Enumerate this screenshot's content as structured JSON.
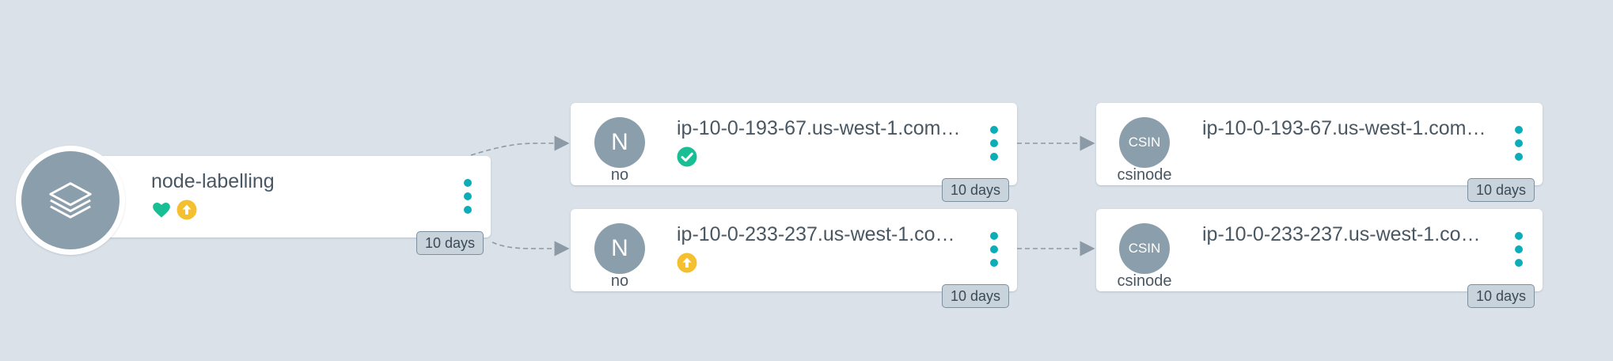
{
  "app_node": {
    "name": "node-labelling",
    "health_icon": "heart-icon",
    "sync_icon": "arrow-up-circle-icon",
    "age": "10 days"
  },
  "resources": [
    {
      "kind": "no",
      "kind_abbrev": "N",
      "name": "ip-10-0-193-67.us-west-1.com…",
      "status_icon": "check-circle-icon",
      "age": "10 days"
    },
    {
      "kind": "no",
      "kind_abbrev": "N",
      "name": "ip-10-0-233-237.us-west-1.co…",
      "status_icon": "arrow-up-circle-icon",
      "age": "10 days"
    },
    {
      "kind": "csinode",
      "kind_abbrev": "CSIN",
      "name": "ip-10-0-193-67.us-west-1.com…",
      "age": "10 days"
    },
    {
      "kind": "csinode",
      "kind_abbrev": "CSIN",
      "name": "ip-10-0-233-237.us-west-1.co…",
      "age": "10 days"
    }
  ],
  "colors": {
    "background": "#dae1e8",
    "healthy": "#18be94",
    "progressing": "#f4c030",
    "menu_dots": "#0dadb8",
    "node_circle": "#8b9eac",
    "edge": "#8b9aa6"
  }
}
